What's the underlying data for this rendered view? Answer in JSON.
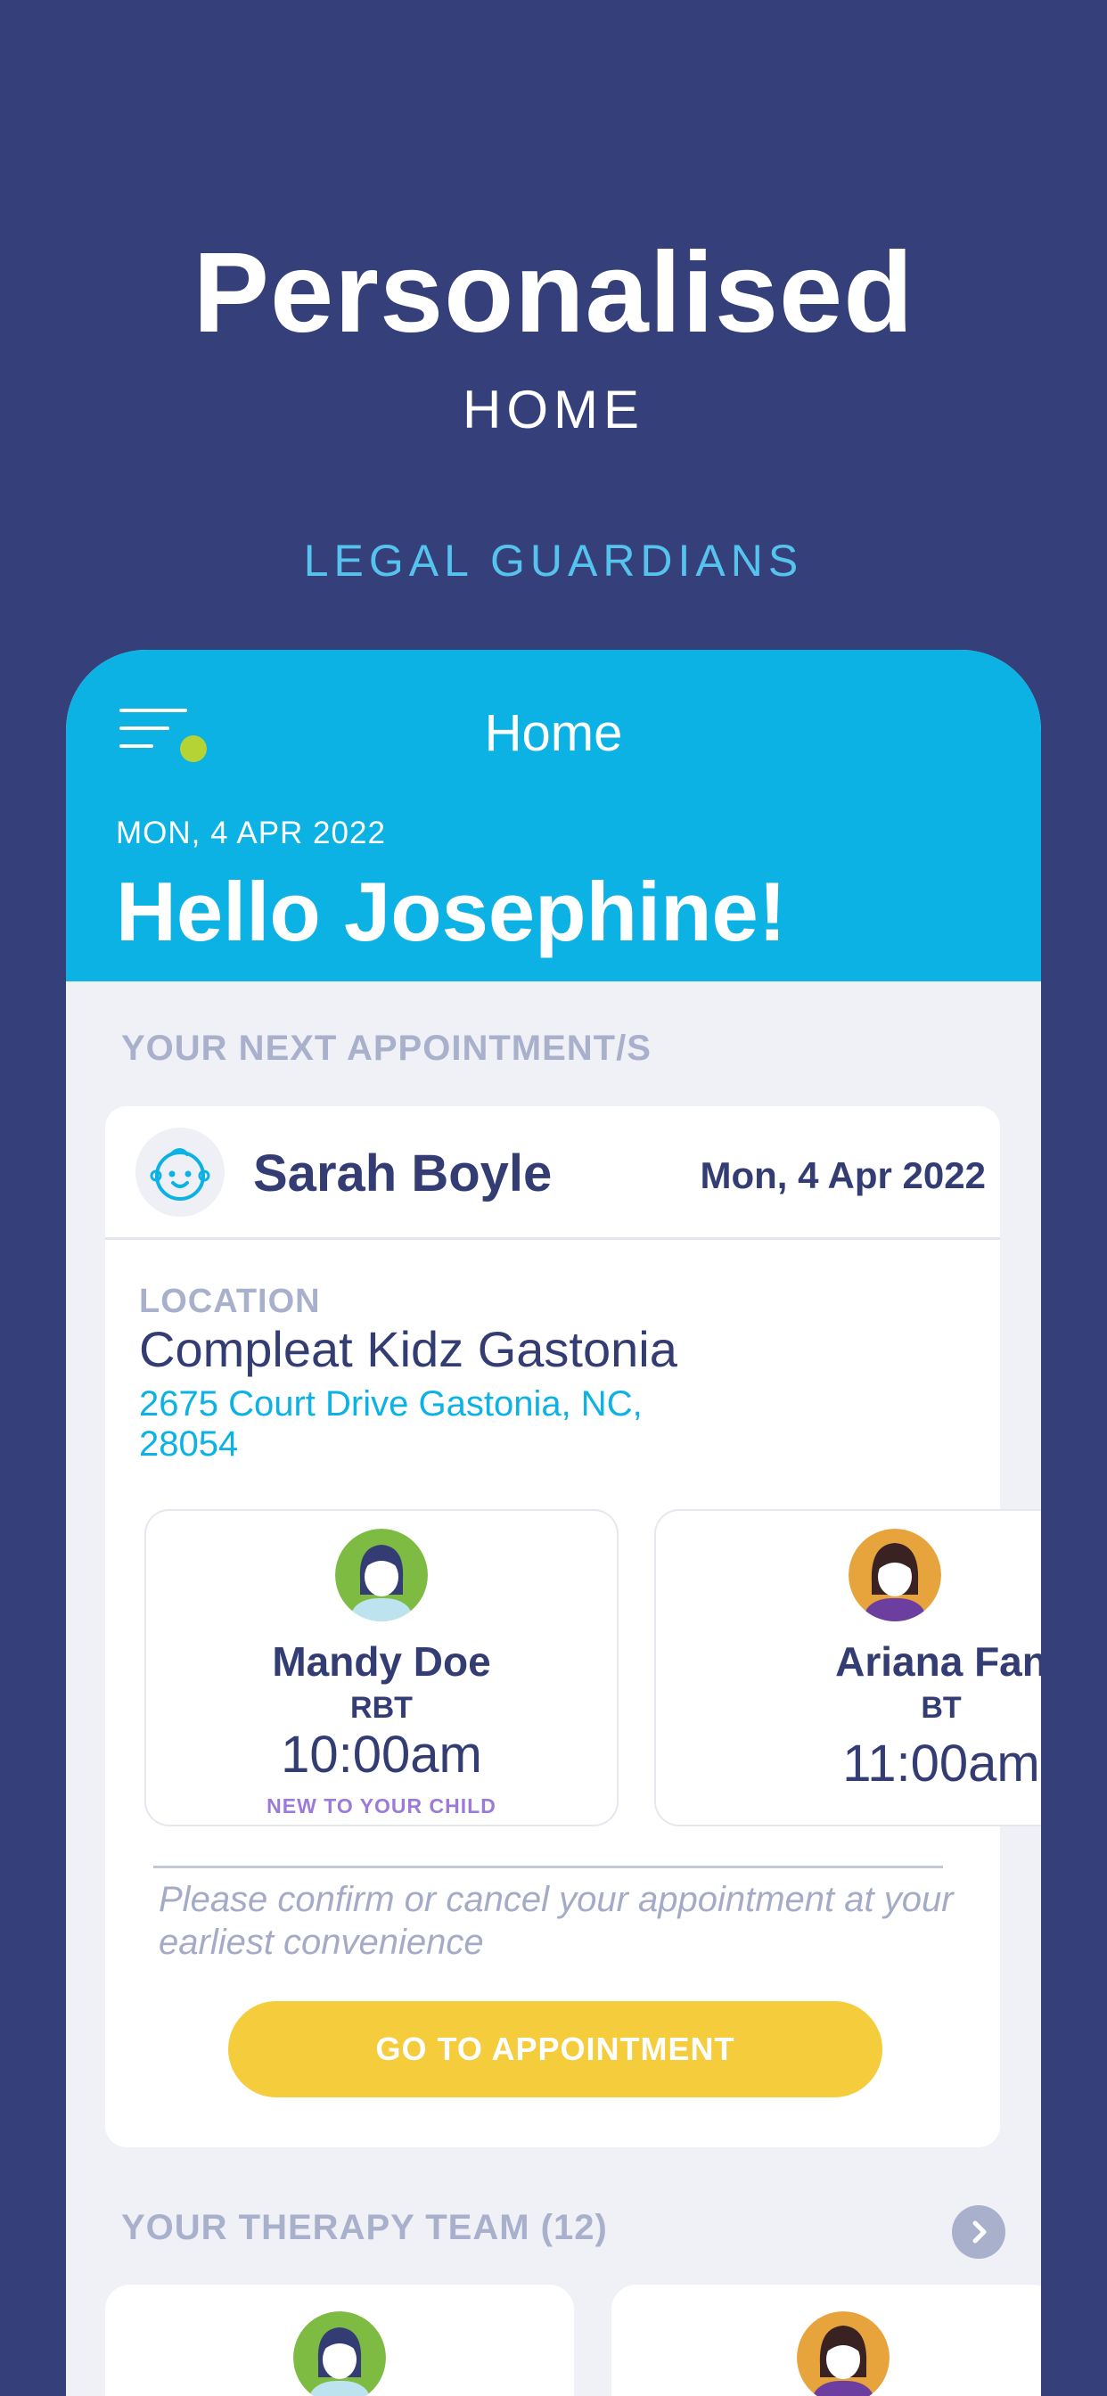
{
  "hero": {
    "title": "Personalised",
    "subtitle": "HOME",
    "category": "LEGAL GUARDIANS"
  },
  "app": {
    "nav_title": "Home",
    "date": "MON, 4 APR 2022",
    "greeting": "Hello Josephine!",
    "next_appointment_label": "YOUR NEXT APPOINTMENT/S",
    "appointment": {
      "child_name": "Sarah Boyle",
      "date": "Mon, 4 Apr 2022",
      "location_label": "LOCATION",
      "location_name": "Compleat Kidz Gastonia",
      "location_address": "2675 Court Drive Gastonia, NC, 28054",
      "therapists": [
        {
          "name": "Mandy Doe",
          "role": "RBT",
          "time": "10:00am",
          "note": "NEW TO YOUR CHILD",
          "avatar_icon": "female-avatar-icon"
        },
        {
          "name": "Ariana Fan",
          "role": "BT",
          "time": "11:00am",
          "avatar_icon": "female-avatar-icon"
        }
      ],
      "confirm_text": "Please confirm or cancel your appointment at your earliest convenience",
      "button_label": "GO TO APPOINTMENT"
    },
    "therapy_team_label": "YOUR THERAPY TEAM (12)"
  },
  "colors": {
    "background": "#353f79",
    "header": "#0bb2e3",
    "primary_text": "#333d74",
    "accent_yellow": "#f5cc3c",
    "menu_dot": "#b5d334"
  }
}
